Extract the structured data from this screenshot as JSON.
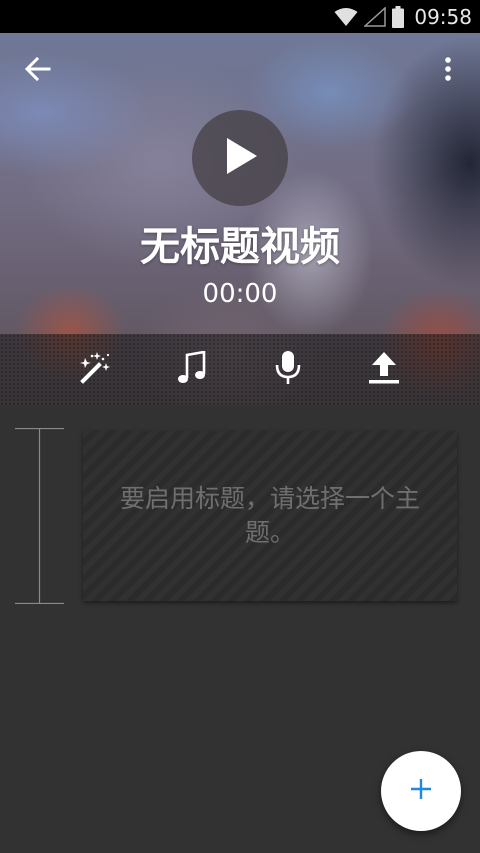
{
  "status_bar": {
    "time": "09:58",
    "icons": [
      "wifi-icon",
      "signal-icon",
      "battery-icon"
    ]
  },
  "header": {
    "back_icon": "arrow-left-icon",
    "menu_icon": "more-vert-icon"
  },
  "player": {
    "play_icon": "play-icon",
    "title": "无标题视频",
    "duration": "00:00"
  },
  "toolbar": {
    "items": [
      {
        "icon": "magic-wand-icon"
      },
      {
        "icon": "music-note-icon"
      },
      {
        "icon": "microphone-icon"
      },
      {
        "icon": "upload-icon"
      }
    ]
  },
  "timeline": {
    "title_card_hint": "要启用标题，请选择一个主题。"
  },
  "fab": {
    "icon": "plus-icon",
    "color": "#1e88e5"
  },
  "colors": {
    "background": "#323232",
    "status_bar": "#000000",
    "accent": "#1e88e5"
  }
}
